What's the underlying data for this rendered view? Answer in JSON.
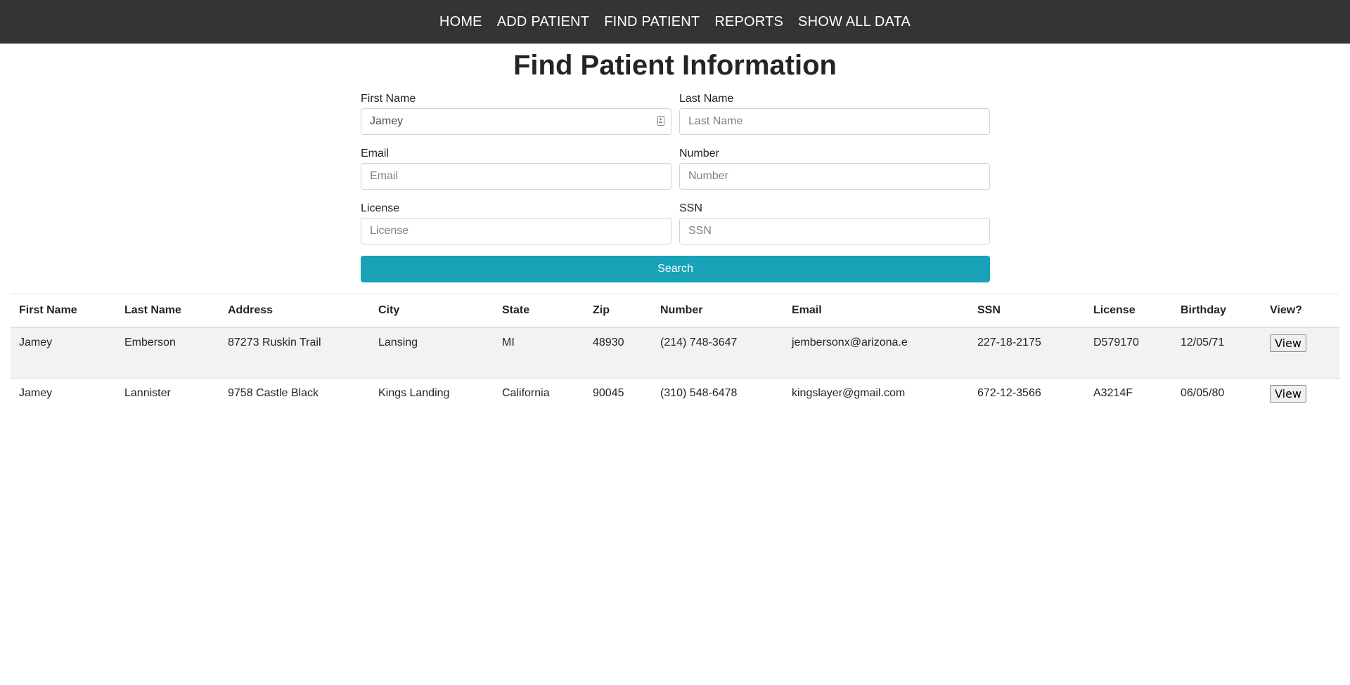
{
  "nav": {
    "items": [
      "HOME",
      "ADD PATIENT",
      "FIND PATIENT",
      "REPORTS",
      "SHOW ALL DATA"
    ]
  },
  "title": "Find Patient Information",
  "form": {
    "first_name": {
      "label": "First Name",
      "value": "Jamey",
      "placeholder": "First Name"
    },
    "last_name": {
      "label": "Last Name",
      "value": "",
      "placeholder": "Last Name"
    },
    "email": {
      "label": "Email",
      "value": "",
      "placeholder": "Email"
    },
    "number": {
      "label": "Number",
      "value": "",
      "placeholder": "Number"
    },
    "license": {
      "label": "License",
      "value": "",
      "placeholder": "License"
    },
    "ssn": {
      "label": "SSN",
      "value": "",
      "placeholder": "SSN"
    },
    "search_label": "Search"
  },
  "table": {
    "headers": [
      "First Name",
      "Last Name",
      "Address",
      "City",
      "State",
      "Zip",
      "Number",
      "Email",
      "SSN",
      "License",
      "Birthday",
      "View?"
    ],
    "rows": [
      {
        "first_name": "Jamey",
        "last_name": "Emberson",
        "address": "87273 Ruskin Trail",
        "city": "Lansing",
        "state": "MI",
        "zip": "48930",
        "number": "(214) 748-3647",
        "email": "jembersonx@arizona.e",
        "ssn": "227-18-2175",
        "license": "D579170",
        "birthday": "12/05/71",
        "view_label": "View"
      },
      {
        "first_name": "Jamey",
        "last_name": "Lannister",
        "address": "9758 Castle Black",
        "city": "Kings Landing",
        "state": "California",
        "zip": "90045",
        "number": "(310) 548-6478",
        "email": "kingslayer@gmail.com",
        "ssn": "672-12-3566",
        "license": "A3214F",
        "birthday": "06/05/80",
        "view_label": "View"
      }
    ]
  },
  "colors": {
    "nav_bg": "#343434",
    "search_button": "#17a2b8",
    "stripe": "#f2f2f2"
  },
  "icons": {
    "autofill": "contact-card-icon"
  }
}
